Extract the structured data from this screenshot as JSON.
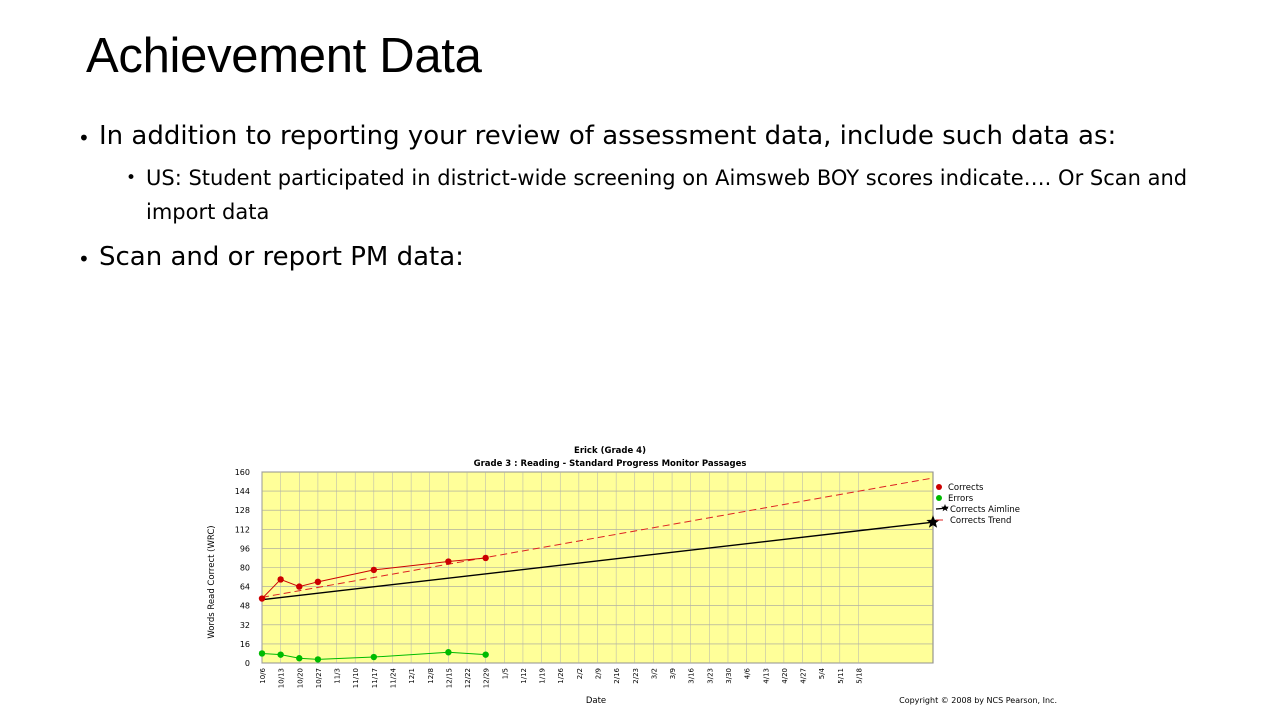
{
  "slide": {
    "title": "Achievement Data",
    "bullets": [
      {
        "level": 1,
        "text": "In addition to reporting your review of assessment data, include such data as:"
      },
      {
        "level": 2,
        "text": "US:  Student participated in district-wide screening on Aimsweb  BOY scores indicate…. Or Scan and import data"
      },
      {
        "level": 1,
        "text": "Scan and or report PM data:"
      }
    ]
  },
  "chart_data": {
    "type": "line",
    "title": "Erick    (Grade 4)",
    "subtitle": "Grade 3 : Reading - Standard Progress Monitor Passages",
    "xlabel": "Date",
    "ylabel": "Words Read Correct (WRC)",
    "ylim": [
      0,
      160
    ],
    "yticks": [
      0,
      16,
      32,
      48,
      64,
      80,
      96,
      112,
      128,
      144,
      160
    ],
    "categories": [
      "10/6",
      "10/13",
      "10/20",
      "10/27",
      "11/3",
      "11/10",
      "11/17",
      "11/24",
      "12/1",
      "12/8",
      "12/15",
      "12/22",
      "12/29",
      "1/5",
      "1/12",
      "1/19",
      "1/26",
      "2/2",
      "2/9",
      "2/16",
      "2/23",
      "3/2",
      "3/9",
      "3/16",
      "3/23",
      "3/30",
      "4/6",
      "4/13",
      "4/20",
      "4/27",
      "5/4",
      "5/11",
      "5/18"
    ],
    "grid": true,
    "legend_position": "right",
    "series": [
      {
        "name": "Corrects",
        "color": "#cc0000",
        "points": [
          [
            0,
            54
          ],
          [
            1,
            70
          ],
          [
            2,
            64
          ],
          [
            3,
            68
          ],
          [
            6,
            78
          ],
          [
            10,
            85
          ],
          [
            12,
            88
          ]
        ]
      },
      {
        "name": "Errors",
        "color": "#00bb00",
        "points": [
          [
            0,
            8
          ],
          [
            1,
            7
          ],
          [
            2,
            4
          ],
          [
            3,
            3
          ],
          [
            6,
            5
          ],
          [
            10,
            9
          ],
          [
            12,
            7
          ]
        ]
      },
      {
        "name": "Corrects Aimline",
        "color": "#000000",
        "points": [
          [
            0,
            53
          ],
          [
            36,
            118
          ]
        ]
      },
      {
        "name": "Corrects Trend",
        "color": "#dd2222",
        "points": [
          [
            0,
            55
          ],
          [
            36,
            155
          ]
        ]
      }
    ],
    "copyright": "Copyright © 2008 by NCS Pearson, Inc."
  }
}
